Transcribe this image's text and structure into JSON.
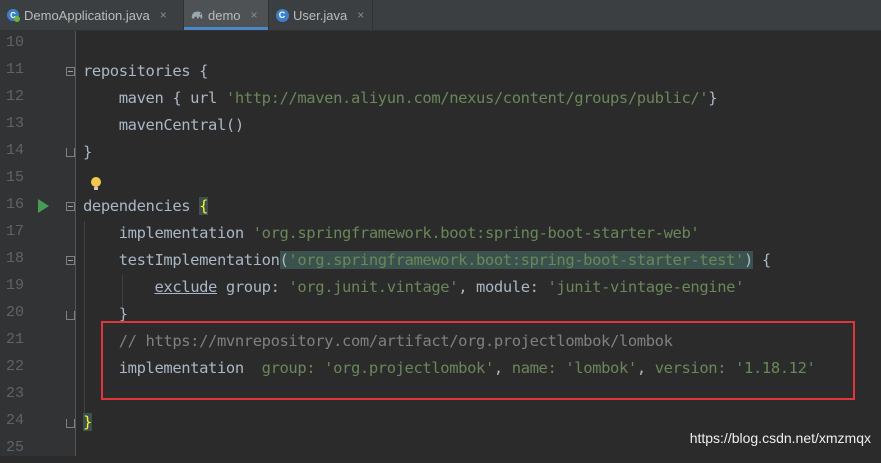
{
  "tabs": [
    {
      "label": "DemoApplication.java",
      "icon": "spring-java-class-icon",
      "active": false
    },
    {
      "label": "demo",
      "icon": "gradle-elephant-icon",
      "active": true
    },
    {
      "label": "User.java",
      "icon": "class-c-icon",
      "active": false
    }
  ],
  "tab_close_glyph": "×",
  "editor": {
    "line_numbers": [
      "10",
      "11",
      "12",
      "13",
      "14",
      "15",
      "16",
      "17",
      "18",
      "19",
      "20",
      "21",
      "22",
      "23",
      "24",
      "25"
    ],
    "code": {
      "l11_a": "repositories {",
      "l12_a": "    maven { url ",
      "l12_s": "'http://maven.aliyun.com/nexus/content/groups/public/'",
      "l12_b": "}",
      "l13_a": "    mavenCentral()",
      "l14_a": "}",
      "l16_a": "dependencies ",
      "l16_b": "{",
      "l17_a": "    implementation ",
      "l17_s": "'org.springframework.boot:spring-boot-starter-web'",
      "l18_a": "    testImplementation",
      "l18_p1": "(",
      "l18_s": "'org.springframework.boot:spring-boot-starter-test'",
      "l18_p2": ")",
      "l18_b": " {",
      "l19_pre": "        ",
      "l19_ex": "exclude",
      "l19_g": " group: ",
      "l19_s1": "'org.junit.vintage'",
      "l19_m": ", module: ",
      "l19_s2": "'junit-vintage-engine'",
      "l20_a": "    }",
      "l21_a": "    // https://mvnrepository.com/artifact/org.projectlombok/lombok",
      "l22_a": "    implementation  ",
      "l22_k1": "group: ",
      "l22_s1": "'org.projectlombok'",
      "l22_c1": ", ",
      "l22_k2": "name: ",
      "l22_s2": "'lombok'",
      "l22_c2": ", ",
      "l22_k3": "version: ",
      "l22_s3": "'1.18.12'",
      "l24_a": "}"
    }
  },
  "watermark": "https://blog.csdn.net/xmzmqx",
  "colors": {
    "background": "#2b2b2b",
    "gutter": "#313335",
    "string": "#6a8759",
    "comment": "#808080",
    "text": "#a9b7c6",
    "highlight_box": "#e0363b",
    "run_icon": "#499c54"
  }
}
